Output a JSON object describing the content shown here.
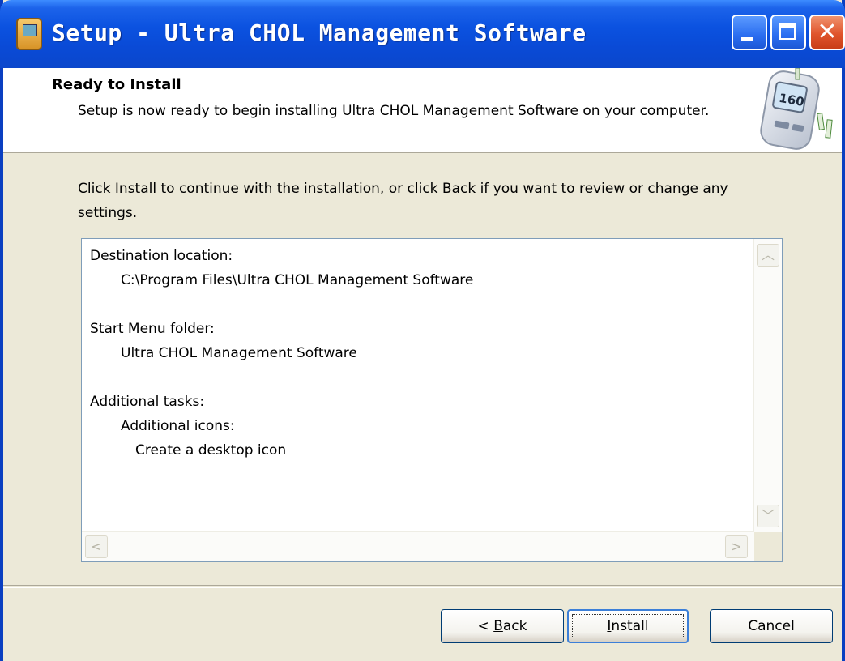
{
  "window": {
    "title": "Setup - Ultra CHOL Management Software",
    "titlebar_color": "#0b52e0"
  },
  "titlebar_controls": {
    "minimize_icon": "minimize-icon",
    "maximize_icon": "maximize-icon",
    "close_icon": "close-icon",
    "close_glyph": "✕"
  },
  "header": {
    "title": "Ready to Install",
    "subtitle": "Setup is now ready to begin installing Ultra CHOL Management Software on your computer.",
    "image": "cholesterol-meter-image",
    "meter_reading": "160"
  },
  "main": {
    "instruction": "Click Install to continue with the installation, or click Back if you want to review or change any settings."
  },
  "summary": {
    "destination_label": "Destination location:",
    "destination_value": "C:\\Program Files\\Ultra CHOL Management Software",
    "start_menu_label": "Start Menu folder:",
    "start_menu_value": "Ultra CHOL Management Software",
    "tasks_label": "Additional tasks:",
    "tasks_group": "Additional icons:",
    "tasks_item": "Create a desktop icon"
  },
  "scrollbars": {
    "up_glyph": "︿",
    "down_glyph": "﹀",
    "left_glyph": "<",
    "right_glyph": ">"
  },
  "buttons": {
    "back_prefix": "< ",
    "back_accel": "B",
    "back_rest": "ack",
    "install_accel": "I",
    "install_rest": "nstall",
    "cancel": "Cancel"
  }
}
